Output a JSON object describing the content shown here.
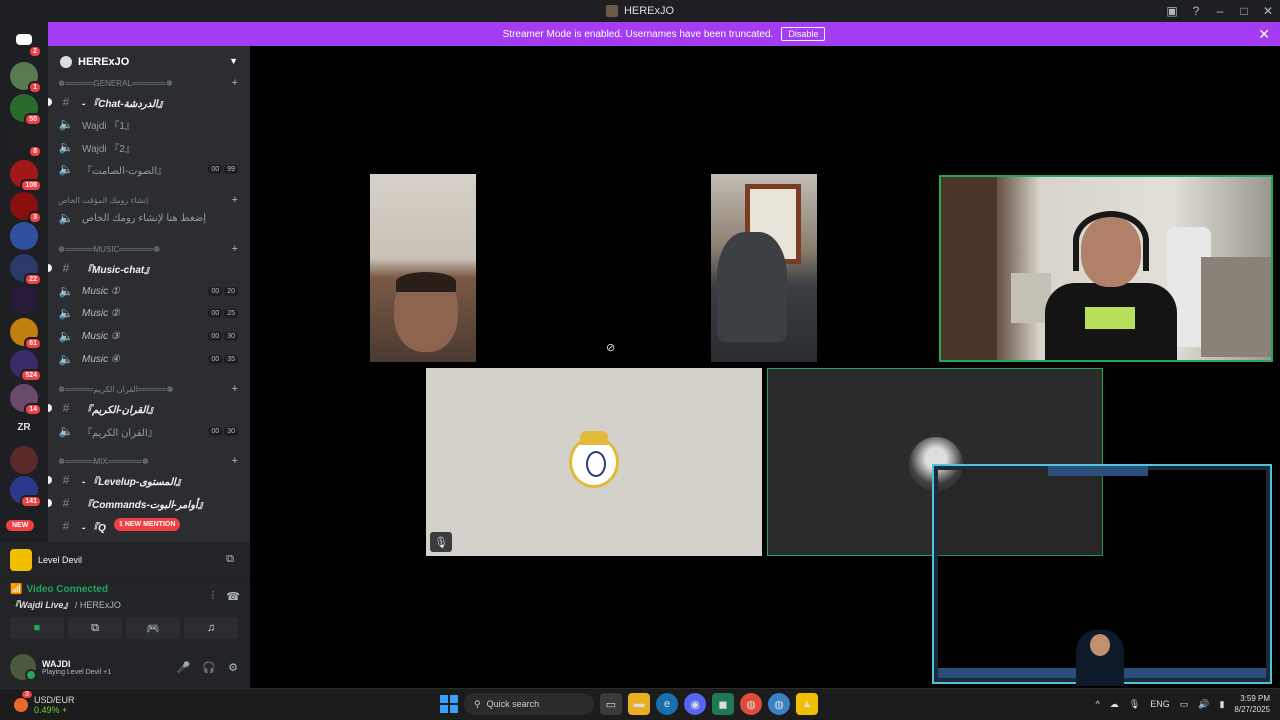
{
  "window": {
    "title": "HERExJO"
  },
  "banner": {
    "text": "Streamer Mode is enabled. Usernames have been truncated.",
    "button": "Disable"
  },
  "servers": [
    {
      "badge": "2"
    },
    {
      "badge": "1"
    },
    {
      "badge": "50"
    },
    {
      "badge": "8"
    },
    {
      "badge": "108"
    },
    {
      "badge": "3"
    },
    {
      "badge": ""
    },
    {
      "badge": "22"
    },
    {
      "badge": ""
    },
    {
      "badge": "61"
    },
    {
      "badge": "524"
    },
    {
      "badge": "14"
    },
    {
      "badge": ""
    },
    {
      "badge": ""
    },
    {
      "badge": "141"
    }
  ],
  "new_pill": "NEW",
  "guild": {
    "name": "HERExJO"
  },
  "categories": {
    "general": "☸═════GENERAL══════☸",
    "temp": "إنشاء رومك المؤقت الخاص",
    "music": "☸═════MUSIC══════☸",
    "quran": "☸═════القران الكريم═════☸",
    "mix": "☸═════MIX══════☸"
  },
  "channels": {
    "chat": "- 『Chat-الدردشة』",
    "wajdi1": "Wajdi 『1』",
    "wajdi2": "Wajdi 『2』",
    "silent": "『الصوت-الصامت』",
    "silent_counts": [
      "00",
      "99"
    ],
    "temp_create": "إضغط هنا لإنشاء رومك الخاص",
    "music_chat": "『Music-chat』",
    "music1": "Music ①",
    "music1_counts": [
      "00",
      "20"
    ],
    "music2": "Music ②",
    "music2_counts": [
      "00",
      "25"
    ],
    "music3": "Music ③",
    "music3_counts": [
      "00",
      "30"
    ],
    "music4": "Music ④",
    "music4_counts": [
      "00",
      "35"
    ],
    "quran_text": "『القران-الكريم』",
    "quran_voice": "『القران الكريم』",
    "quran_counts": [
      "00",
      "30"
    ],
    "levelup": "- 『Levelup-المستوى』",
    "commands": "『Commands-أوامر-البوت』",
    "q": "- 『Q"
  },
  "mention_pill": "1 NEW MENTION",
  "activity": {
    "game": "Level Devil"
  },
  "voice": {
    "status": "Video Connected",
    "channel": "『Wajdi Live』",
    "guild": "/ HERExJO"
  },
  "user": {
    "name": "WAJDI",
    "status": "Playing Level Devil",
    "extra": "+1"
  },
  "taskbar": {
    "ticker": "USD/EUR",
    "ticker_change": "0.49% +",
    "ticker_badge": "3",
    "search": "Quick search",
    "lang": "ENG",
    "time": "3:59 PM",
    "date": "8/27/2025"
  }
}
